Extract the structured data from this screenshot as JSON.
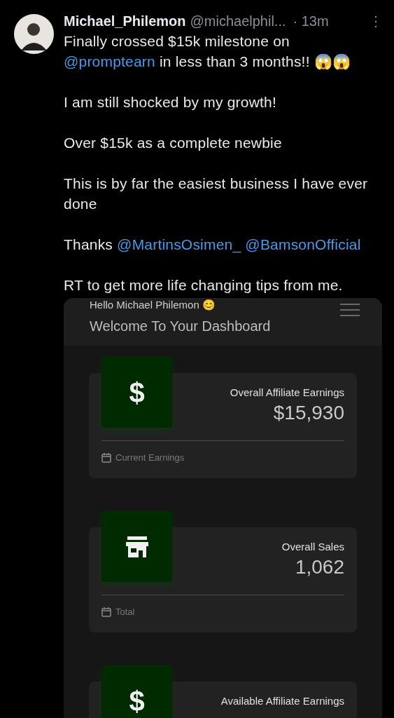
{
  "post": {
    "author": "Michael_Philemon",
    "handle": "@michaelphil...",
    "time": "· 13m",
    "more_icon": "⋮",
    "paragraphs": [
      [
        {
          "kind": "text",
          "text": "Finally crossed $15k milestone on "
        },
        {
          "kind": "mention",
          "text": "@promptearn"
        },
        {
          "kind": "text",
          "text": " in less than 3 months!! 😱😱"
        }
      ],
      [
        {
          "kind": "text",
          "text": "I am still shocked by my growth!"
        }
      ],
      [
        {
          "kind": "text",
          "text": "Over $15k as a complete newbie"
        }
      ],
      [
        {
          "kind": "text",
          "text": "This is by far the easiest business I have ever done"
        }
      ],
      [
        {
          "kind": "text",
          "text": "Thanks "
        },
        {
          "kind": "mention",
          "text": "@MartinsOsimen_"
        },
        {
          "kind": "mention",
          "text": "@BamsonOfficial"
        }
      ],
      [
        {
          "kind": "text",
          "text": "RT to get more life changing tips from me."
        }
      ]
    ]
  },
  "dashboard": {
    "greeting": "Hello Michael Philemon 😊",
    "title": "Welcome To Your Dashboard",
    "cards": [
      {
        "kind": "dollar",
        "icon_glyph": "$",
        "label": "Overall Affiliate Earnings",
        "value": "$15,930",
        "footer": "Current Earnings"
      },
      {
        "kind": "store",
        "label": "Overall Sales",
        "value": "1,062",
        "footer": "Total"
      },
      {
        "kind": "dollar",
        "icon_glyph": "$",
        "label": "Available Affiliate Earnings"
      }
    ]
  }
}
